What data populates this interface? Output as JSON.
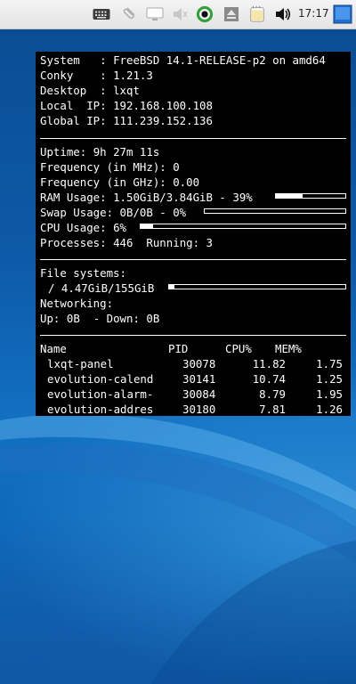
{
  "panel": {
    "clock": "17:17"
  },
  "conky": {
    "system_label": "System",
    "system_value": "FreeBSD 14.1-RELEASE-p2 on amd64",
    "conky_label": "Conky",
    "conky_value": "1.21.3",
    "desktop_label": "Desktop",
    "desktop_value": "lxqt",
    "local_ip_label": "Local  IP:",
    "local_ip_value": "192.168.100.108",
    "global_ip_label": "Global IP:",
    "global_ip_value": "111.239.152.136",
    "uptime_label": "Uptime:",
    "uptime_value": "9h 27m 11s",
    "freq_mhz_label": "Frequency (in MHz):",
    "freq_mhz_value": "0",
    "freq_ghz_label": "Frequency (in GHz):",
    "freq_ghz_value": "0.00",
    "ram_label": "RAM Usage:",
    "ram_value": "1.50GiB/3.84GiB - 39%",
    "ram_fraction": 0.39,
    "swap_label": "Swap Usage:",
    "swap_value": "0B/0B - 0%",
    "swap_fraction": 0.0,
    "cpu_label": "CPU Usage:",
    "cpu_value": "6%",
    "cpu_fraction": 0.06,
    "processes_label": "Processes:",
    "processes_value": "446",
    "running_label": "Running:",
    "running_value": "3",
    "fs_label": "File systems:",
    "fs_value": "/ 4.47GiB/155GiB",
    "fs_fraction": 0.029,
    "net_label": "Networking:",
    "up_label": "Up:",
    "up_value": "0B",
    "down_label": "- Down:",
    "down_value": "0B",
    "table_headers": [
      "Name",
      "PID",
      "CPU%",
      "MEM%"
    ],
    "processes": [
      {
        "name": "lxqt-panel",
        "pid": "30078",
        "cpu": "11.82",
        "mem": "1.75"
      },
      {
        "name": "evolution-calend",
        "pid": "30141",
        "cpu": "10.74",
        "mem": "1.25"
      },
      {
        "name": "evolution-alarm-",
        "pid": "30084",
        "cpu": "8.79",
        "mem": "1.95"
      },
      {
        "name": "evolution-addres",
        "pid": "30180",
        "cpu": "7.81",
        "mem": "1.26"
      }
    ]
  },
  "colors": {
    "desktop_blue": "#0d5aa8",
    "panel_bg": "#ececec",
    "conky_bg": "#000000",
    "conky_fg": "#ffffff",
    "status_green": "#2fa33a"
  },
  "icons": [
    "keyboard-icon",
    "clipboard-icon",
    "display-icon",
    "speaker-muted-icon",
    "record-icon",
    "eject-icon",
    "notes-icon",
    "volume-icon",
    "show-desktop-icon"
  ]
}
